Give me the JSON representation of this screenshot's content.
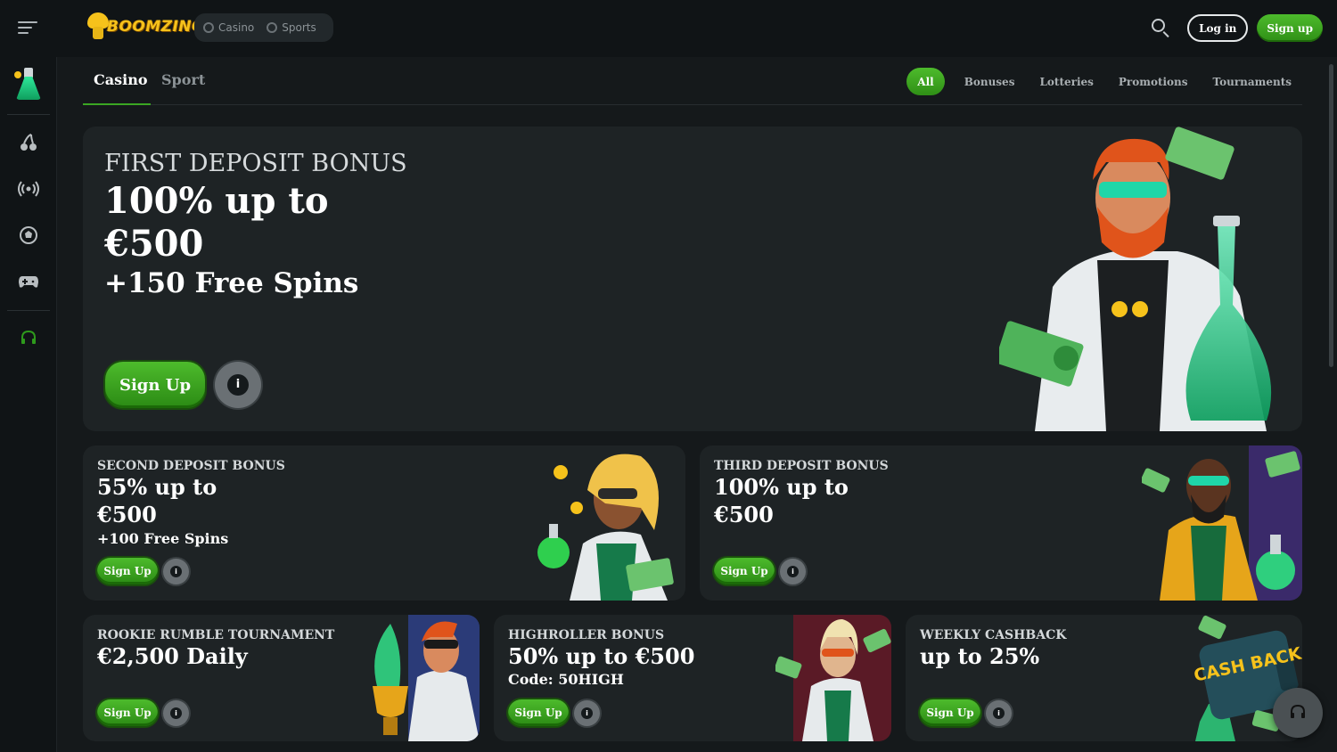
{
  "brand": {
    "logo_text": "BOOMZINO"
  },
  "topbar": {
    "modes": [
      "Casino",
      "Sports"
    ],
    "login_label": "Log in",
    "signup_label": "Sign up"
  },
  "tabs": {
    "items": [
      "Casino",
      "Sport"
    ],
    "active": "Casino"
  },
  "filters": {
    "items": [
      "All",
      "Bonuses",
      "Lotteries",
      "Promotions",
      "Tournaments"
    ],
    "active": "All"
  },
  "hero": {
    "title": "FIRST DEPOSIT BONUS",
    "line1": "100% up to",
    "line2": "€500",
    "line3": "+150 Free Spins",
    "cta": "Sign Up"
  },
  "cards": [
    {
      "title": "SECOND DEPOSIT BONUS",
      "line1": "55% up to",
      "line2": "€500",
      "line3": "+100 Free Spins",
      "cta": "Sign Up"
    },
    {
      "title": "THIRD DEPOSIT BONUS",
      "line1": "100% up to",
      "line2": "€500",
      "line3": "",
      "cta": "Sign Up"
    },
    {
      "title": "ROOKIE RUMBLE TOURNAMENT",
      "line1": "€2,500 Daily",
      "line2": "",
      "cta": "Sign Up"
    },
    {
      "title": "HIGHROLLER BONUS",
      "line1": "50% up to €500",
      "line2": "Code: 50HIGH",
      "cta": "Sign Up"
    },
    {
      "title": "WEEKLY CASHBACK",
      "line1": "up to 25%",
      "line2": "",
      "cta": "Sign Up",
      "art_text": "CASH BACK"
    }
  ],
  "colors": {
    "accent": "#3aa622",
    "bg": "#15191b",
    "card": "#1e2325",
    "brand_yellow": "#f6c21b"
  },
  "icons": [
    "menu-icon",
    "search-icon",
    "cherry-icon",
    "live-icon",
    "football-icon",
    "gamepad-icon",
    "headset-icon",
    "info-icon"
  ]
}
